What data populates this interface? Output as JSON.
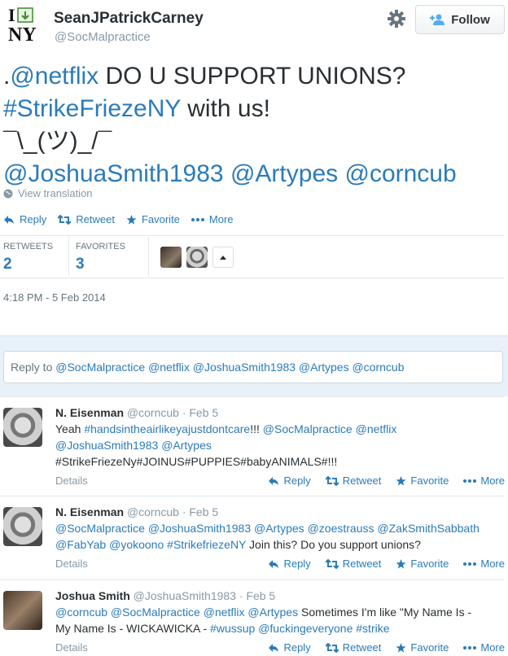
{
  "header": {
    "logo_alt": "I ♥ NY",
    "name": "SeanJPatrickCarney",
    "handle": "@SocMalpractice",
    "follow_label": "Follow"
  },
  "tweet": {
    "lines": [
      [
        {
          "t": ".",
          "c": "text"
        },
        {
          "t": "@netflix",
          "c": "link"
        },
        {
          "t": " DO U SUPPORT UNIONS?",
          "c": "text"
        }
      ],
      [
        {
          "t": "#StrikeFriezeNY",
          "c": "link"
        },
        {
          "t": " with us!",
          "c": "text"
        }
      ],
      [
        {
          "t": "¯\\_(ツ)_/¯",
          "c": "text"
        }
      ],
      [
        {
          "t": "@JoshuaSmith1983",
          "c": "link"
        },
        {
          "t": " ",
          "c": "text"
        },
        {
          "t": "@Artypes",
          "c": "link"
        },
        {
          "t": " ",
          "c": "text"
        },
        {
          "t": "@corncub",
          "c": "link"
        }
      ]
    ],
    "view_translation": "View translation",
    "actions": {
      "reply": "Reply",
      "retweet": "Retweet",
      "favorite": "Favorite",
      "more": "More"
    },
    "stats": {
      "retweets_label": "RETWEETS",
      "retweets": "2",
      "favorites_label": "FAVORITES",
      "favorites": "3"
    },
    "timestamp": "4:18 PM - 5 Feb 2014"
  },
  "reply_box": {
    "prefix": "Reply to ",
    "mentions": "@SocMalpractice @netflix @JoshuaSmith1983 @Artypes @corncub"
  },
  "replies": [
    {
      "name": "N. Eisenman",
      "meta": "@corncub · Feb 5",
      "lines": [
        [
          {
            "t": "Yeah ",
            "c": "text"
          },
          {
            "t": "#handsintheairlikeyajustdontcare",
            "c": "link"
          },
          {
            "t": "!!! ",
            "c": "text"
          },
          {
            "t": "@SocMalpractice",
            "c": "link"
          },
          {
            "t": " ",
            "c": "text"
          },
          {
            "t": "@netflix",
            "c": "link"
          }
        ],
        [
          {
            "t": "@JoshuaSmith1983",
            "c": "link"
          },
          {
            "t": " ",
            "c": "text"
          },
          {
            "t": "@Artypes",
            "c": "link"
          }
        ],
        [
          {
            "t": "#StrikeFriezeNy#JOINUS#PUPPIES#babyANIMALS#!!!",
            "c": "text"
          }
        ]
      ],
      "details": "Details",
      "actions": {
        "reply": "Reply",
        "retweet": "Retweet",
        "favorite": "Favorite",
        "more": "More"
      }
    },
    {
      "name": "N. Eisenman",
      "meta": "@corncub · Feb 5",
      "lines": [
        [
          {
            "t": "@SocMalpractice",
            "c": "link"
          },
          {
            "t": " ",
            "c": "text"
          },
          {
            "t": "@JoshuaSmith1983",
            "c": "link"
          },
          {
            "t": " ",
            "c": "text"
          },
          {
            "t": "@Artypes",
            "c": "link"
          },
          {
            "t": " ",
            "c": "text"
          },
          {
            "t": "@zoestrauss",
            "c": "link"
          },
          {
            "t": " ",
            "c": "text"
          },
          {
            "t": "@ZakSmithSabbath",
            "c": "link"
          }
        ],
        [
          {
            "t": "@FabYab",
            "c": "link"
          },
          {
            "t": " ",
            "c": "text"
          },
          {
            "t": "@yokoono",
            "c": "link"
          },
          {
            "t": "  ",
            "c": "text"
          },
          {
            "t": "#StrikefriezeNY",
            "c": "link"
          },
          {
            "t": " Join this? Do you support unions?",
            "c": "text"
          }
        ]
      ],
      "details": "Details",
      "actions": {
        "reply": "Reply",
        "retweet": "Retweet",
        "favorite": "Favorite",
        "more": "More"
      }
    },
    {
      "name": "Joshua Smith",
      "meta": "@JoshuaSmith1983 · Feb 5",
      "lines": [
        [
          {
            "t": "@corncub",
            "c": "link"
          },
          {
            "t": " ",
            "c": "text"
          },
          {
            "t": "@SocMalpractice",
            "c": "link"
          },
          {
            "t": " ",
            "c": "text"
          },
          {
            "t": "@netflix",
            "c": "link"
          },
          {
            "t": " ",
            "c": "text"
          },
          {
            "t": "@Artypes",
            "c": "link"
          },
          {
            "t": " Sometimes I'm like \"My Name Is -",
            "c": "text"
          }
        ],
        [
          {
            "t": "My Name Is - WICKAWICKA - ",
            "c": "text"
          },
          {
            "t": "#wussup",
            "c": "link"
          },
          {
            "t": " ",
            "c": "text"
          },
          {
            "t": "@fuckingeveryone",
            "c": "link"
          },
          {
            "t": " ",
            "c": "text"
          },
          {
            "t": "#strike",
            "c": "link"
          }
        ]
      ],
      "details": "Details",
      "actions": {
        "reply": "Reply",
        "retweet": "Retweet",
        "favorite": "Favorite",
        "more": "More"
      }
    }
  ],
  "colors": {
    "link": "#2b7bb9",
    "text": "#292f33",
    "muted": "#8899a6",
    "reply_bg": "#e8f1f8"
  },
  "icons": [
    "gear-icon",
    "follow-person-icon",
    "globe-icon",
    "reply-icon",
    "retweet-icon",
    "favorite-star-icon",
    "more-dots-icon",
    "caret-up-icon"
  ]
}
